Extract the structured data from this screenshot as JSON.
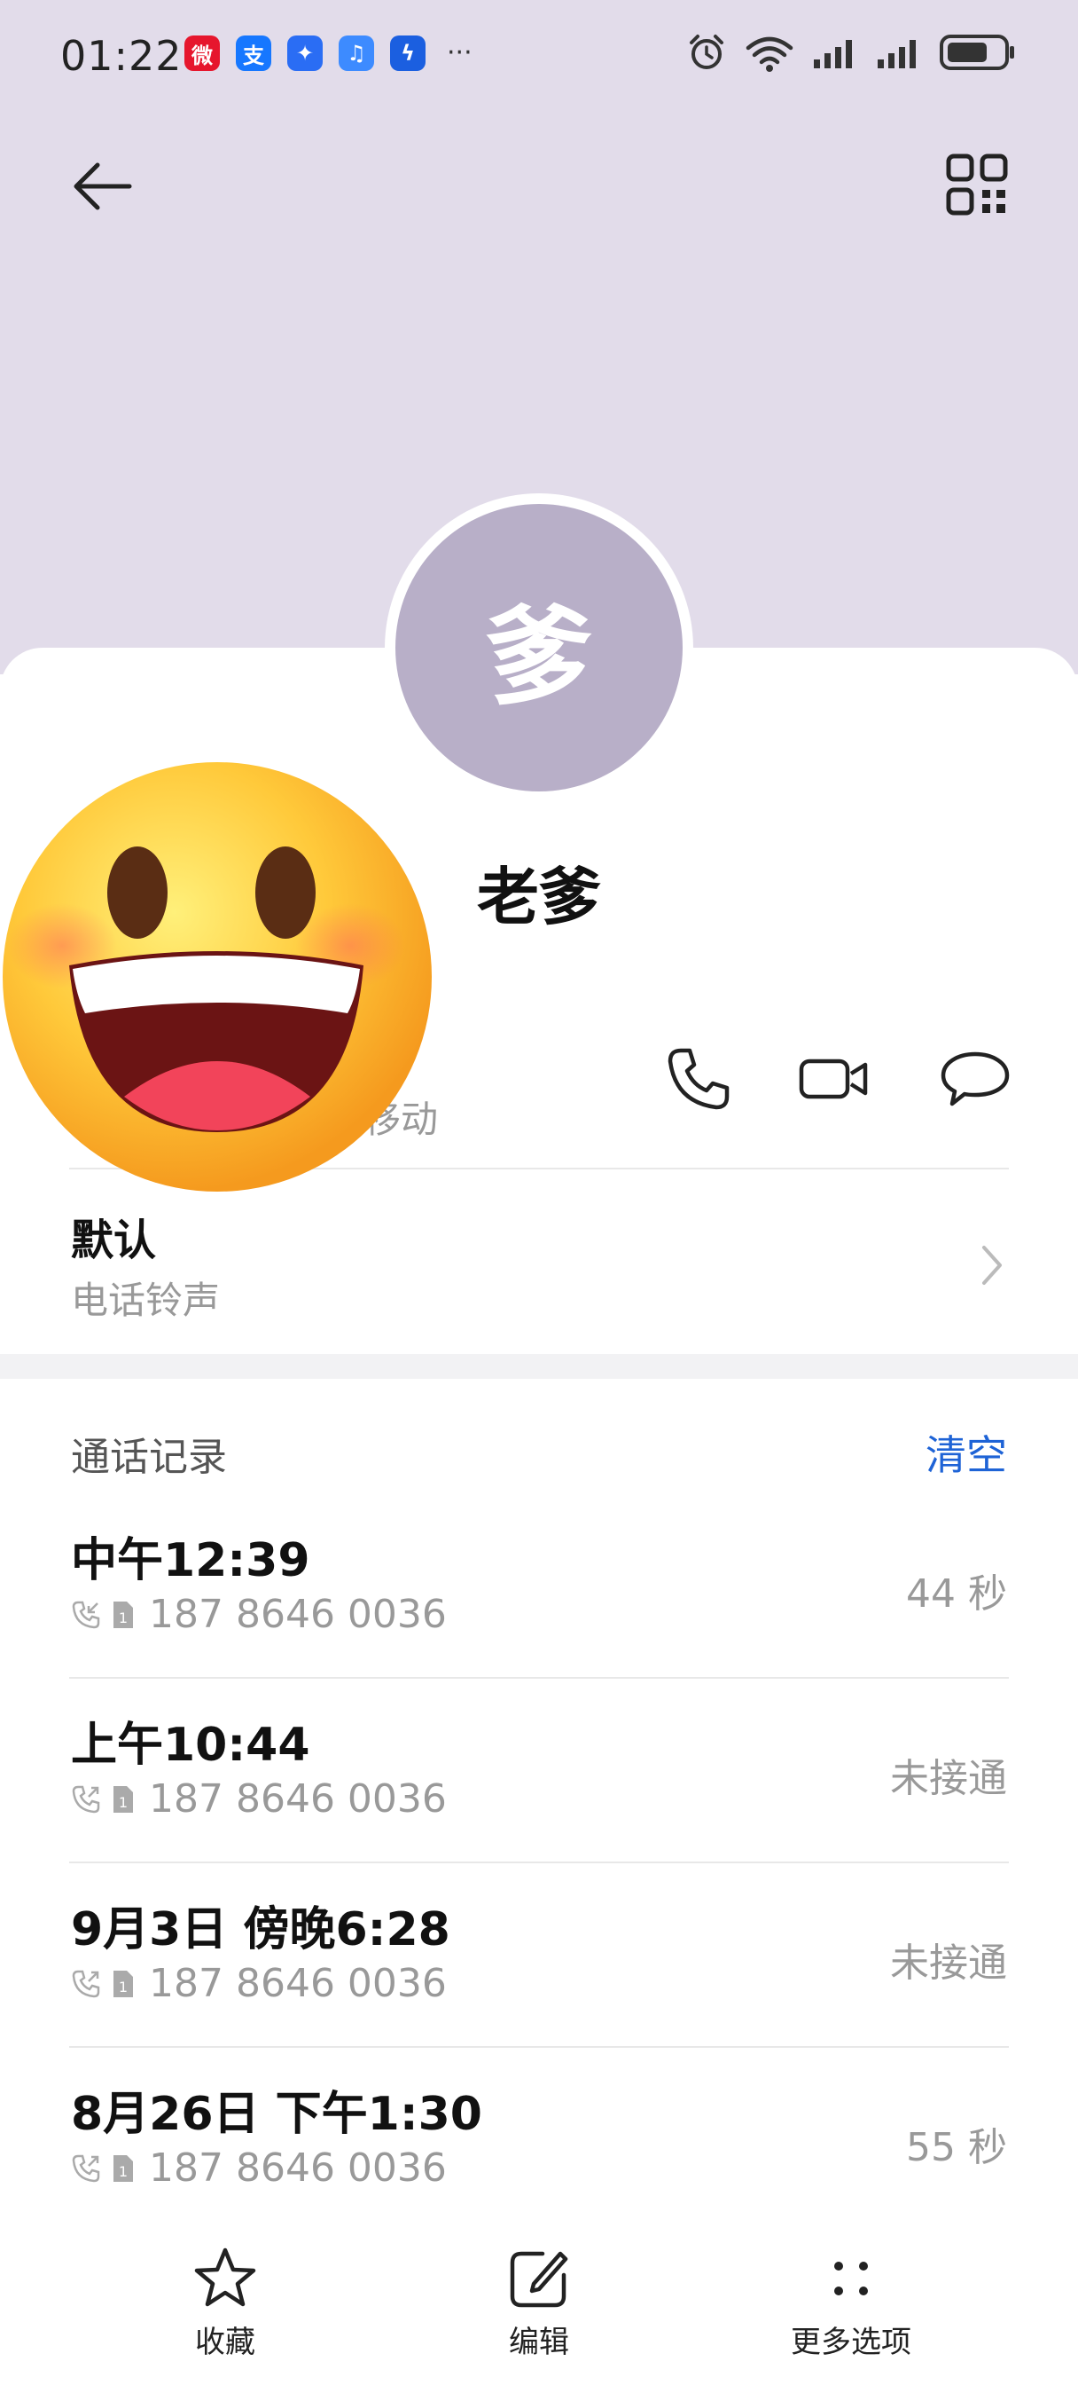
{
  "status_bar": {
    "time": "01:22",
    "apps": [
      {
        "icon": "weibo-icon",
        "glyph": "微",
        "color": "#e6162d"
      },
      {
        "icon": "alipay-icon",
        "glyph": "支",
        "color": "#1677ff"
      },
      {
        "icon": "bulb-app-icon",
        "glyph": "✦",
        "color": "#2a6df4"
      },
      {
        "icon": "music-app-icon",
        "glyph": "♫",
        "color": "#3d8bff"
      },
      {
        "icon": "bolt-app-icon",
        "glyph": "ϟ",
        "color": "#1b5fe0"
      }
    ],
    "more": "···",
    "right_icons": [
      "alarm-icon",
      "wifi-icon",
      "signal-icon",
      "signal-icon",
      "battery-icon"
    ]
  },
  "header": {
    "back_icon": "arrow-left-icon",
    "qr_icon": "qr-code-icon"
  },
  "contact": {
    "avatar_char": "爹",
    "name": "老爹",
    "carrier": "移动"
  },
  "actions": [
    {
      "icon": "phone-icon"
    },
    {
      "icon": "video-call-icon"
    },
    {
      "icon": "message-icon"
    }
  ],
  "ringtone": {
    "value": "默认",
    "label": "电话铃声"
  },
  "call_log": {
    "title": "通话记录",
    "clear": "清空",
    "entries": [
      {
        "time": "中午12:39",
        "number": "187 8646 0036",
        "result": "44 秒",
        "type": "incoming"
      },
      {
        "time": "上午10:44",
        "number": "187 8646 0036",
        "result": "未接通",
        "type": "outgoing"
      },
      {
        "time": "9月3日 傍晚6:28",
        "number": "187 8646 0036",
        "result": "未接通",
        "type": "outgoing"
      },
      {
        "time": "8月26日 下午1:30",
        "number": "187 8646 0036",
        "result": "55 秒",
        "type": "outgoing"
      }
    ]
  },
  "bottom_bar": {
    "items": [
      {
        "label": "收藏",
        "icon": "star-icon"
      },
      {
        "label": "编辑",
        "icon": "edit-icon"
      },
      {
        "label": "更多选项",
        "icon": "more-options-icon"
      }
    ]
  },
  "colors": {
    "header_bg": "#e2dcea",
    "avatar_bg": "#b8afc8",
    "accent": "#1e63d6"
  }
}
